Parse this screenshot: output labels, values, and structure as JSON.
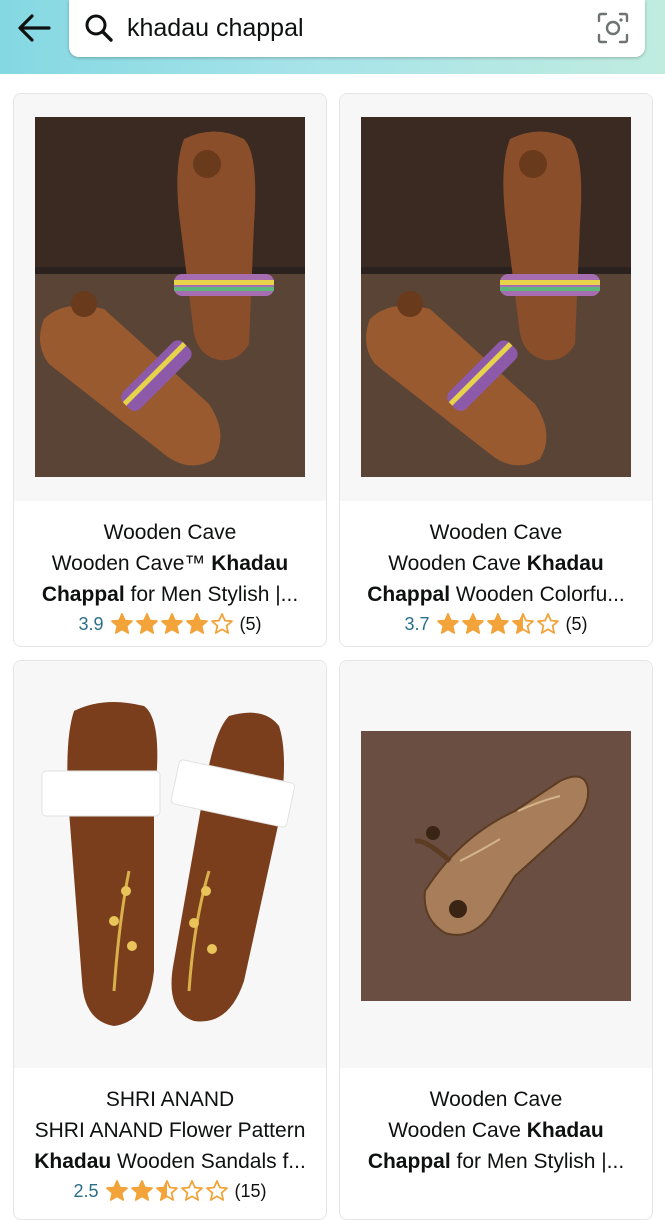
{
  "search": {
    "query": "khadau chappal"
  },
  "colors": {
    "star": "#f2a33a",
    "rating": "#2a6f87"
  },
  "products": [
    {
      "brand": "Wooden Cave",
      "title_parts": [
        {
          "t": "Wooden Cave™ ",
          "b": false
        },
        {
          "t": "Khadau",
          "b": true
        },
        {
          "t": " ",
          "b": false
        },
        {
          "t": "Chappal",
          "b": true
        },
        {
          "t": " for Men Stylish |...",
          "b": false
        }
      ],
      "rating": "3.9",
      "rating_value": 3.9,
      "reviews": "(5)",
      "image": "wooden khadau pair on dark wood"
    },
    {
      "brand": "Wooden Cave",
      "title_parts": [
        {
          "t": "Wooden Cave ",
          "b": false
        },
        {
          "t": "Khadau",
          "b": true
        },
        {
          "t": " ",
          "b": false
        },
        {
          "t": "Chappal",
          "b": true
        },
        {
          "t": " Wooden Colorfu...",
          "b": false
        }
      ],
      "rating": "3.7",
      "rating_value": 3.7,
      "reviews": "(5)",
      "image": "wooden khadau pair on dark wood"
    },
    {
      "brand": "SHRI ANAND",
      "title_parts": [
        {
          "t": "SHRI ANAND Flower Pattern ",
          "b": false
        },
        {
          "t": "Khadau",
          "b": true
        },
        {
          "t": " Wooden Sandals f...",
          "b": false
        }
      ],
      "rating": "2.5",
      "rating_value": 2.5,
      "reviews": "(15)",
      "image": "wooden sandals with white straps"
    },
    {
      "brand": "Wooden Cave",
      "title_parts": [
        {
          "t": "Wooden Cave ",
          "b": false
        },
        {
          "t": "Khadau",
          "b": true
        },
        {
          "t": " ",
          "b": false
        },
        {
          "t": "Chappal",
          "b": true
        },
        {
          "t": " for Men Stylish |...",
          "b": false
        }
      ],
      "rating": "",
      "rating_value": null,
      "reviews": "",
      "image": "carved wooden khadau on brown background"
    }
  ]
}
